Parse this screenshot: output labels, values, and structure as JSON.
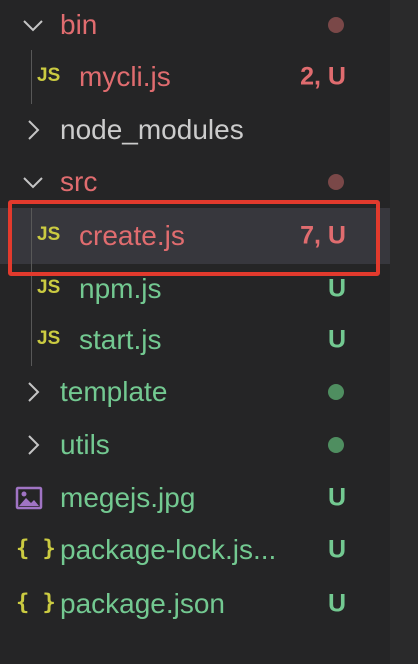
{
  "explorer": {
    "items": [
      {
        "label": "bin",
        "status": ""
      },
      {
        "label": "mycli.js",
        "icon_text": "JS",
        "status": "2, U"
      },
      {
        "label": "node_modules",
        "status": ""
      },
      {
        "label": "src",
        "status": ""
      },
      {
        "label": "create.js",
        "icon_text": "JS",
        "status": "7, U"
      },
      {
        "label": "npm.js",
        "icon_text": "JS",
        "status": "U"
      },
      {
        "label": "start.js",
        "icon_text": "JS",
        "status": "U"
      },
      {
        "label": "template",
        "status": ""
      },
      {
        "label": "utils",
        "status": ""
      },
      {
        "label": "megejs.jpg",
        "status": "U"
      },
      {
        "label": "package-lock.js...",
        "icon_text": "{ }",
        "status": "U"
      },
      {
        "label": "package.json",
        "icon_text": "{ }",
        "status": "U"
      }
    ]
  },
  "colors": {
    "background": "#252526",
    "error_red": "#e06c6f",
    "untracked_green": "#73c991",
    "js_yellow": "#cbcb41",
    "image_purple": "#a074c4",
    "highlight_box": "#e23a2d"
  },
  "icons": {
    "chevron_open": "chevron-down-icon",
    "chevron_closed": "chevron-right-icon",
    "js_file": "javascript-file-icon",
    "json_file": "json-file-icon",
    "image_file": "image-file-icon"
  }
}
